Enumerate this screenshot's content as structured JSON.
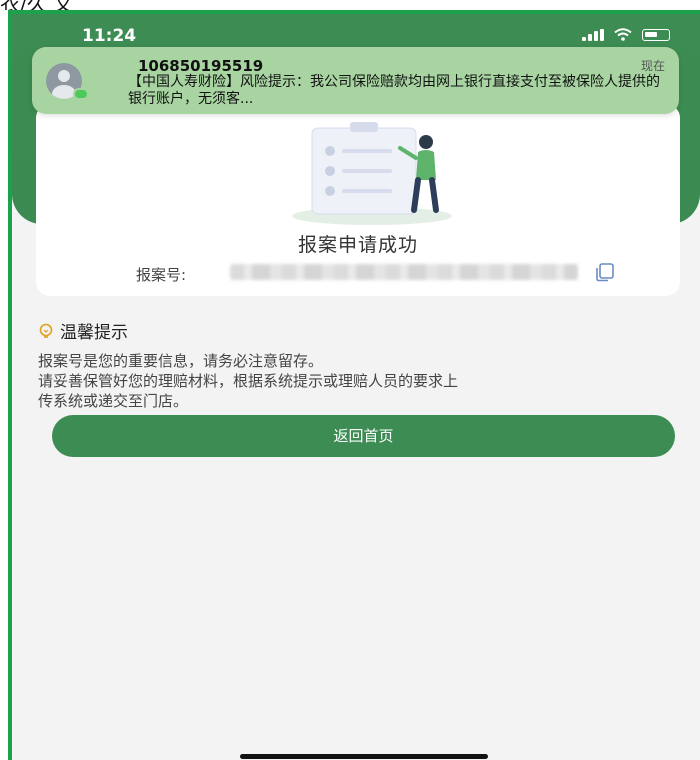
{
  "top_fragment": "衣/久 又",
  "status_bar": {
    "time": "11:24"
  },
  "notification": {
    "sender": "106850195519",
    "time": "现在",
    "body": "【中国人寿财险】风险提示：我公司保险赔款均由网上银行直接支付至被保险人提供的银行账户，无须客..."
  },
  "card": {
    "title": "报案申请成功",
    "case_label": "报案号:"
  },
  "tips": {
    "title": "温馨提示",
    "lines": [
      "报案号是您的重要信息，请务必注意留存。",
      "请妥善保管好您的理赔材料，根据系统提示或理赔人员的要求上",
      "传系统或递交至门店。"
    ]
  },
  "button": {
    "label": "返回首页"
  },
  "colors": {
    "brand_green": "#3d8c53",
    "frame_green": "#1aa34a",
    "notification_bg": "#a8d4a2"
  }
}
